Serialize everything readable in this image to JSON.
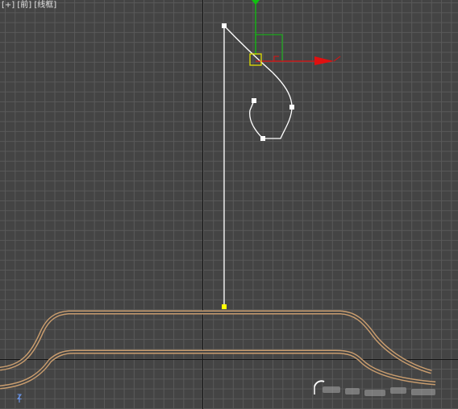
{
  "viewport": {
    "label_plus": "[+]",
    "label_view": "[前]",
    "label_shading": "[线框]",
    "axis_z_label": "Z"
  },
  "colors": {
    "background": "#444444",
    "grid": "#595959",
    "world_axis": "#151515",
    "spline_selected": "#ffffff",
    "vertex_first": "#ffff00",
    "gizmo_x": "#e01010",
    "gizmo_y": "#10c010",
    "gizmo_plane": "#e0e000",
    "surface_outline": "#c89c6e"
  },
  "icons": {
    "transform_gizmo": "move-gizmo-icon",
    "view_axis_indicator": "axis-tripod-icon"
  }
}
